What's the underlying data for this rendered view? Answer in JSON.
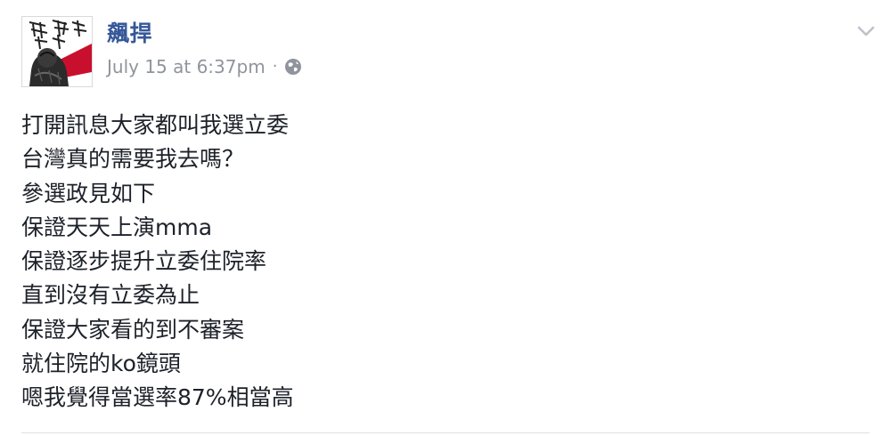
{
  "post": {
    "author": "飆捍",
    "timestamp": "July 15 at 6:37pm",
    "separator": "·",
    "privacy_icon": "globe-icon",
    "menu_icon": "chevron-down-icon",
    "avatar_text": "飆捍",
    "lines": [
      "打開訊息大家都叫我選立委",
      "台灣真的需要我去嗎？",
      "參選政見如下",
      "保證天天上演mma",
      "保證逐步提升立委住院率",
      "直到沒有立委為止",
      "保證大家看的到不審案",
      "就住院的ko鏡頭",
      "嗯我覺得當選率87%相當高"
    ]
  },
  "colors": {
    "author": "#365899",
    "meta": "#90949c",
    "text": "#1d2129",
    "divider": "#dddfe2",
    "avatar_accent": "#c8102e"
  }
}
